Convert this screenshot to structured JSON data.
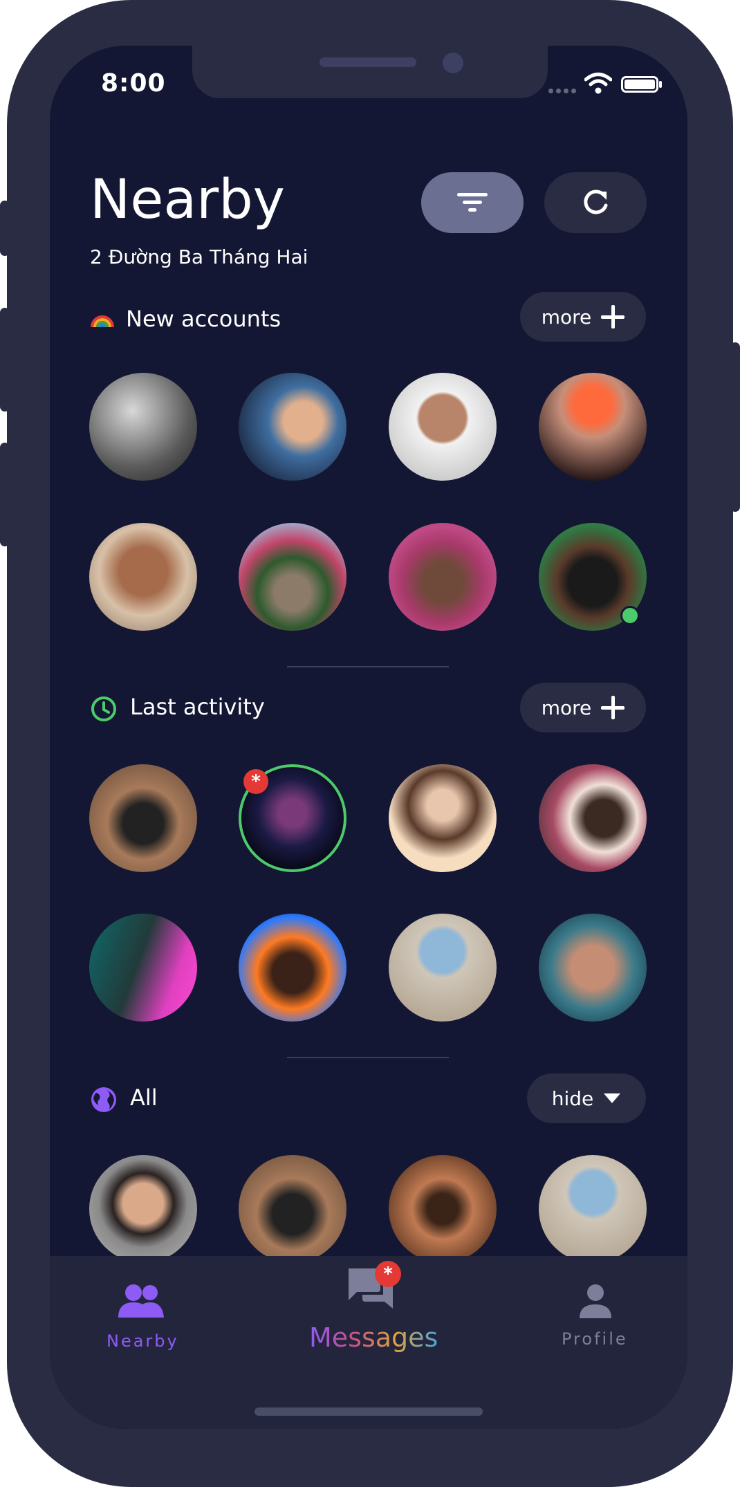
{
  "status_bar": {
    "time": "8:00"
  },
  "header": {
    "title": "Nearby",
    "address": "2 Đường Ba Tháng Hai",
    "filter_icon": "filter-icon",
    "refresh_icon": "refresh-icon"
  },
  "sections": [
    {
      "title": "New accounts",
      "icon": "rainbow-icon",
      "action": "more"
    },
    {
      "title": "Last activity",
      "icon": "clock-icon",
      "action": "more"
    },
    {
      "title": "All",
      "icon": "globe-icon",
      "action": "hide"
    }
  ],
  "colors": {
    "background": "#141733",
    "frame": "#292c43",
    "accent_purple": "#8e5bf5",
    "online_green": "#4ccb6a",
    "badge_red": "#e53935"
  },
  "new_message_badge": "*",
  "tabbar": {
    "nearby": "Nearby",
    "messages": "Messages",
    "profile": "Profile"
  }
}
